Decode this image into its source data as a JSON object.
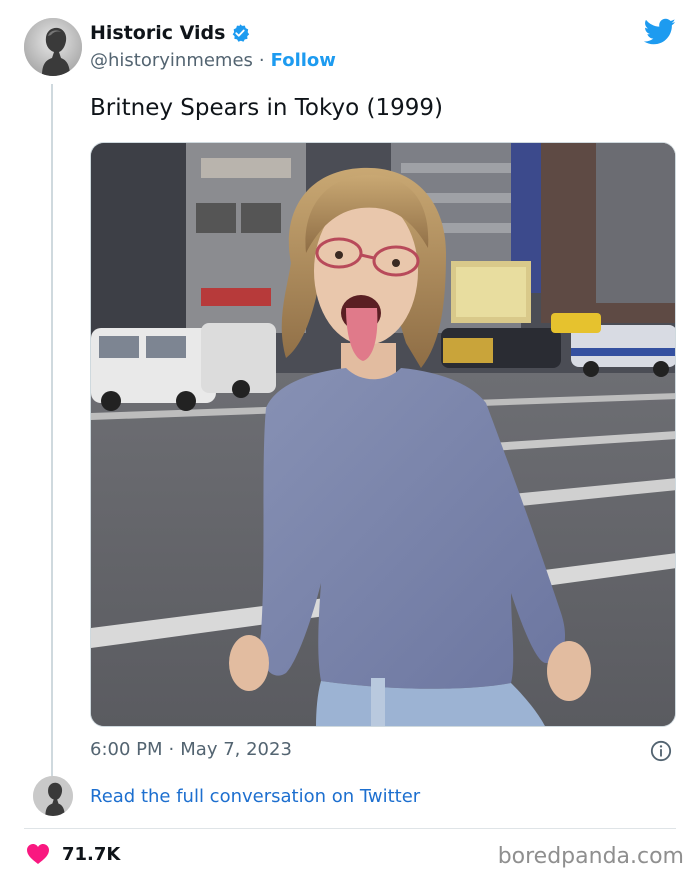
{
  "tweet": {
    "display_name": "Historic Vids",
    "handle": "@historyinmemes",
    "separator": "·",
    "follow_label": "Follow",
    "text": "Britney Spears in Tokyo (1999)",
    "time": "6:00 PM",
    "date": "May 7, 2023",
    "read_more": "Read the full conversation on Twitter",
    "like_count": "71.7K"
  },
  "footer": {
    "watermark": "boredpanda.com"
  },
  "colors": {
    "twitter_blue": "#1d9bf0",
    "heart": "#f91880",
    "link": "#1d6fcf"
  },
  "icons": [
    "verified-badge-icon",
    "twitter-bird-icon",
    "info-icon",
    "heart-icon"
  ]
}
